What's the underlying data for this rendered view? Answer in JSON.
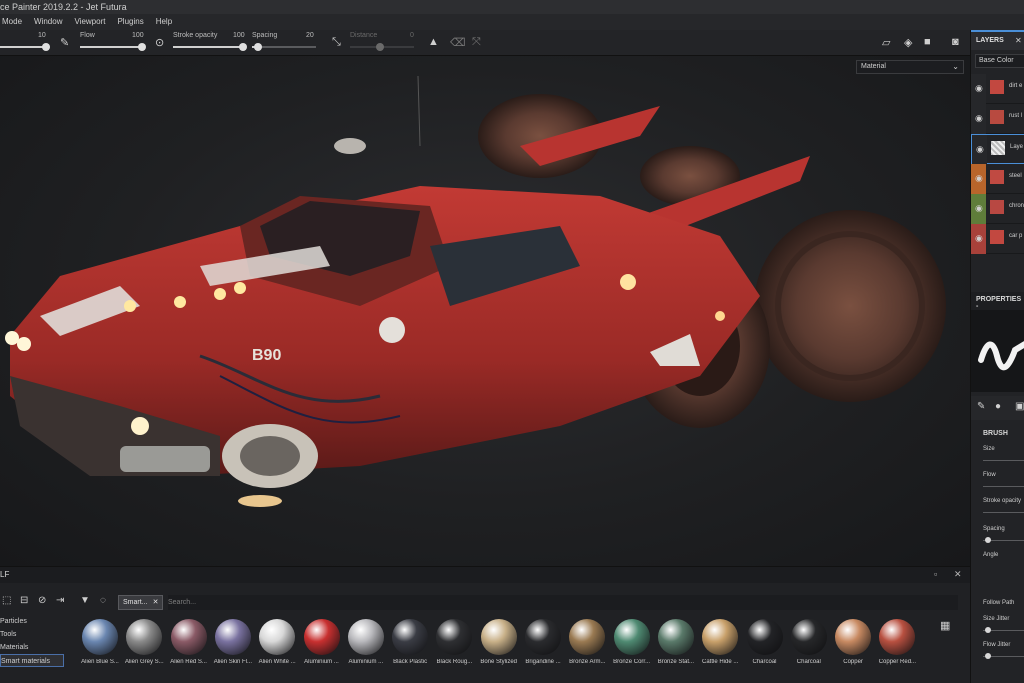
{
  "window": {
    "title": "ce Painter 2019.2.2 - Jet Futura"
  },
  "menu": [
    "Mode",
    "Window",
    "Viewport",
    "Plugins",
    "Help"
  ],
  "toolbar": {
    "size_value": "10",
    "flow_label": "Flow",
    "flow_value": "100",
    "stroke_opacity_label": "Stroke opacity",
    "stroke_opacity_value": "100",
    "spacing_label": "Spacing",
    "spacing_value": "20",
    "distance_label": "Distance",
    "distance_value": "0"
  },
  "viewport": {
    "channel": "Material"
  },
  "layers_panel": {
    "title": "LAYERS",
    "channel": "Base Color",
    "layers": [
      {
        "name": "dirt e",
        "band_color": "#26272a"
      },
      {
        "name": "rust l",
        "band_color": "#26272a"
      },
      {
        "name": "Laye",
        "band_color": "#26272a"
      },
      {
        "name": "steel",
        "band_color": "#b8652b"
      },
      {
        "name": "chron",
        "band_color": "#5f7d3a"
      },
      {
        "name": "car p",
        "band_color": "#a8413a"
      }
    ]
  },
  "properties_panel": {
    "title": "PROPERTIES -",
    "section": "BRUSH",
    "props": [
      "Size",
      "Flow",
      "Stroke opacity",
      "Spacing",
      "Angle",
      "Follow Path",
      "Size Jitter",
      "Flow Jitter"
    ]
  },
  "shelf": {
    "title": "LF",
    "filter_tag": "Smart...",
    "search_placeholder": "Search...",
    "categories": [
      "Particles",
      "Tools",
      "Materials",
      "Smart materials"
    ],
    "materials": [
      {
        "label": "Alien Blue S...",
        "color": "#6a86b0"
      },
      {
        "label": "Alien Grey S...",
        "color": "#8a8a8a"
      },
      {
        "label": "Alien Red S...",
        "color": "#8a5a66"
      },
      {
        "label": "Alien Skin Fl...",
        "color": "#7a72a0"
      },
      {
        "label": "Alien White ...",
        "color": "#d8d8d8"
      },
      {
        "label": "Aluminium ...",
        "color": "#c83030"
      },
      {
        "label": "Aluminium ...",
        "color": "#b8b8bc"
      },
      {
        "label": "Black Plastic",
        "color": "#3a3c44"
      },
      {
        "label": "Black Roug...",
        "color": "#2e2f32"
      },
      {
        "label": "Bone Stylized",
        "color": "#c8b088"
      },
      {
        "label": "Brigandine ...",
        "color": "#2a2b2e"
      },
      {
        "label": "Bronze Arm...",
        "color": "#9a7a52"
      },
      {
        "label": "Bronze Corr...",
        "color": "#4f8a72"
      },
      {
        "label": "Bronze Stat...",
        "color": "#5a7a6a"
      },
      {
        "label": "Cattle Hide ...",
        "color": "#c8a06a"
      },
      {
        "label": "Charcoal",
        "color": "#222326"
      },
      {
        "label": "Charcoal",
        "color": "#262729"
      },
      {
        "label": "Copper",
        "color": "#c88a62"
      },
      {
        "label": "Copper Red...",
        "color": "#b85040"
      }
    ]
  }
}
